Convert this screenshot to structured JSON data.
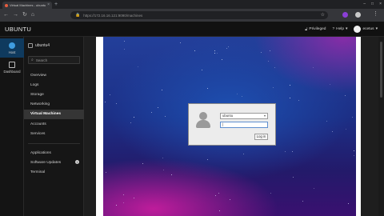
{
  "browser": {
    "tab_title": "Virtual Machines - ubuntu4",
    "tab_close": "×",
    "new_tab": "+",
    "window_controls": [
      "–",
      "□",
      "×"
    ],
    "nav_glyphs": [
      "←",
      "→",
      "↻",
      "⌂"
    ],
    "url": "https://172.16.16.121:9090/machines",
    "lock_glyph": "🔒",
    "star_glyph": "☆",
    "menu_glyph": "⋮"
  },
  "header": {
    "brand": "UBUNTU",
    "privileged": "Privileged",
    "help": "Help",
    "user": "ecetus"
  },
  "rail": {
    "host": "Host",
    "dashboard": "Dashboard"
  },
  "sidebar": {
    "host_name": "ubuntu4",
    "search_placeholder": "Search",
    "search_glyph": "⌕",
    "group1": [
      "Overview",
      "Logs",
      "Storage",
      "Networking",
      "Virtual Machines",
      "Accounts",
      "Services"
    ],
    "group2": [
      "Applications",
      "Software Updates",
      "Terminal"
    ],
    "info_glyph": "i"
  },
  "login": {
    "username": "ubuntu",
    "password": "|",
    "login_button": "Log in",
    "chevron": "▾"
  },
  "colors": {
    "accent": "#3f9de0",
    "active_nav": "#353535",
    "header_bg": "#111111"
  }
}
